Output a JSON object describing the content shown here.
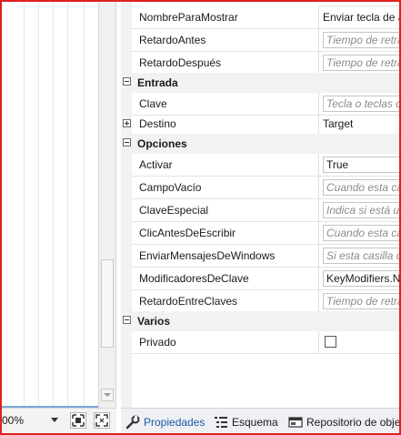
{
  "zoom": {
    "value": "00%"
  },
  "properties": {
    "rows_top": [
      {
        "name": "NombreParaMostrar",
        "value": "Enviar tecla de a",
        "placeholder": false
      },
      {
        "name": "RetardoAntes",
        "value": "Tiempo de retra",
        "placeholder": true
      },
      {
        "name": "RetardoDespués",
        "value": "Tiempo de retra",
        "placeholder": true
      }
    ],
    "cat_entrada": "Entrada",
    "rows_entrada": [
      {
        "name": "Clave",
        "value": "Tecla o teclas q",
        "placeholder": true
      },
      {
        "name": "Destino",
        "value": "Target",
        "placeholder": false
      }
    ],
    "cat_opciones": "Opciones",
    "rows_opciones": [
      {
        "name": "Activar",
        "value": "True",
        "placeholder": false
      },
      {
        "name": "CampoVacío",
        "value": "Cuando esta cas",
        "placeholder": true
      },
      {
        "name": "ClaveEspecial",
        "value": "Indica si está uti",
        "placeholder": true
      },
      {
        "name": "ClicAntesDeEscribir",
        "value": "Cuando esta cas",
        "placeholder": true
      },
      {
        "name": "EnviarMensajesDeWindows",
        "value": "Si esta casilla d",
        "placeholder": true
      },
      {
        "name": "ModificadoresDeClave",
        "value": "KeyModifiers.No",
        "placeholder": false
      },
      {
        "name": "RetardoEntreClaves",
        "value": "Tiempo de retra",
        "placeholder": true
      }
    ],
    "cat_varios": "Varios",
    "rows_varios": [
      {
        "name": "Privado",
        "value": "",
        "checked": false
      }
    ]
  },
  "tabs": [
    {
      "label": "Propiedades",
      "icon": "wrench-icon"
    },
    {
      "label": "Esquema",
      "icon": "outline-list-icon"
    },
    {
      "label": "Repositorio de obje",
      "icon": "repository-icon"
    }
  ],
  "colors": {
    "accent": "#1c5aa8",
    "frame": "#e02020",
    "placeholder": "#8c8c8c"
  }
}
